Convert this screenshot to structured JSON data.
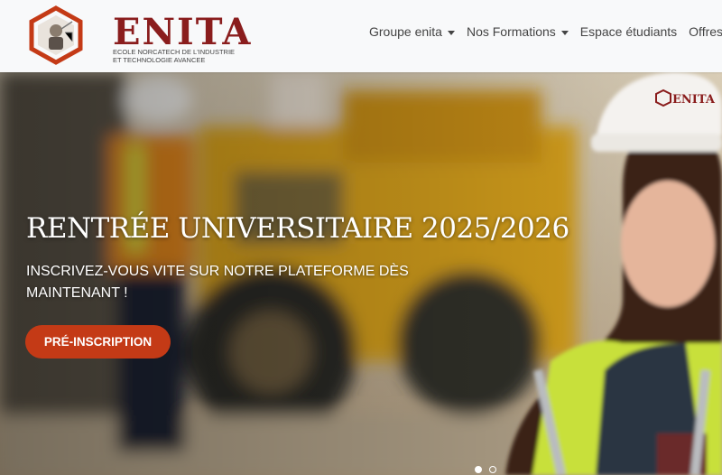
{
  "brand": {
    "name": "ENITA",
    "tagline_line1": "ECOLE NORCATECH DE L'INDUSTRIE",
    "tagline_line2": "ET TECHNOLOGIE AVANCEE",
    "color": "#8a1d1d"
  },
  "nav": {
    "items": [
      {
        "label": "Groupe enita",
        "dropdown": true
      },
      {
        "label": "Nos Formations",
        "dropdown": true
      },
      {
        "label": "Espace étudiants",
        "dropdown": false
      },
      {
        "label": "Offres Er",
        "dropdown": false
      }
    ]
  },
  "hero": {
    "title": "RENTRÉE UNIVERSITAIRE 2025/2026",
    "subtitle": "INSCRIVEZ-VOUS VITE SUR NOTRE PLATEFORME DÈS MAINTENANT !",
    "cta_label": "PRÉ-INSCRIPTION",
    "cta_color": "#c43a16",
    "helmet_text": "ENITA",
    "slides": 2,
    "active_slide": 1
  }
}
